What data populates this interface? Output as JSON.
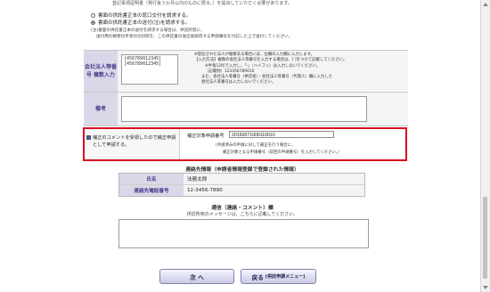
{
  "top_note": "登記事項証明書（発行後３か月以内のものに限る。）を提出していただく必要があります。",
  "delivery_options": [
    {
      "label": "書面の供託書正本の窓口交付を請求する。",
      "selected": false
    },
    {
      "label": "書面の供託書正本の送付(注)を請求する。",
      "selected": true
    }
  ],
  "delivery_notes": [
    "(注)書面の供託書正本の送付を請求する場合は、供託所宛に、",
    "送付用の郵便切手等付の封筒を、この供託書の送信後取得する申請番号を付記した上で送付してください。"
  ],
  "corp_number": {
    "label": "会社法人等番号 複数入力",
    "values": "[456789012345]\n[456789012345]",
    "notes": [
      "※登記された法人が複数ある場合には、左欄の入力欄に入力します。",
      "【入力方法】複数の会社法人等番号を入力する場合は、[ ]をつけて記載してください。",
      "※半角12桁で入力し、「‐」（ハイフン）は入力しないでください。",
      "（記載例）123456789010",
      "また、会社法人等番号（供託者）・会社法人等番号（代理人）欄に入力した",
      "会社法人等番号は入力しないでください。"
    ]
  },
  "remarks": {
    "label": "備考",
    "value": ""
  },
  "correction": {
    "checkbox_label": "補正のコメントを受領したので補正申請として申請する。",
    "checked": true,
    "field_label": "補正対象申請番号",
    "field_value": "20150071000110010",
    "notes": [
      "(申請済みの申請に対して補正を行う場合に、",
      "補正対象となる申請番号（前回の申請番号）を入力してください。）"
    ]
  },
  "contact": {
    "title": "連絡先情報（申請者情報登録で登録された情報）",
    "name_label": "氏名",
    "name_value": "法務太郎",
    "phone_label": "連絡先電話番号",
    "phone_value": "12-3456-7890"
  },
  "communication": {
    "title": "通信（連絡・コメント）欄",
    "subtitle": "供託所宛のメッセージは、こちらに記載してください。",
    "value": ""
  },
  "buttons": {
    "next_label": "次 へ",
    "back_label": "戻る",
    "back_sub": "(供託申請メニュー)"
  }
}
